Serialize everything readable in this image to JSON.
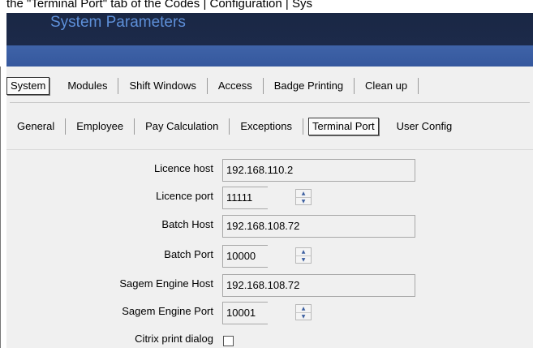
{
  "caption": "the \"Terminal Port\" tab of the Codes | Configuration | Sys",
  "window": {
    "title": "System Parameters"
  },
  "main_tabs": [
    "System",
    "Modules",
    "Shift Windows",
    "Access",
    "Badge Printing",
    "Clean up"
  ],
  "main_active": "System",
  "sub_tabs": [
    "General",
    "Employee",
    "Pay Calculation",
    "Exceptions",
    "Terminal Port",
    "User Config"
  ],
  "sub_active": "Terminal Port",
  "fields": [
    {
      "label": "Licence host",
      "value": "192.168.110.2"
    },
    {
      "label": "Licence port",
      "value": "11111"
    },
    {
      "label": "Batch Host",
      "value": "192.168.108.72"
    },
    {
      "label": "Batch Port",
      "value": "10000"
    },
    {
      "label": "Sagem Engine Host",
      "value": "192.168.108.72"
    },
    {
      "label": "Sagem Engine Port",
      "value": "10001"
    },
    {
      "label": "Citrix print dialog",
      "checked": false
    }
  ],
  "colors": {
    "title_bg": "#1a2744",
    "band": "#3f63a8",
    "title_text": "#5d8fd8",
    "panel": "#f0f0f0"
  },
  "icons": {
    "spinner_up": "spinner-up-icon",
    "spinner_down": "spinner-down-icon"
  }
}
